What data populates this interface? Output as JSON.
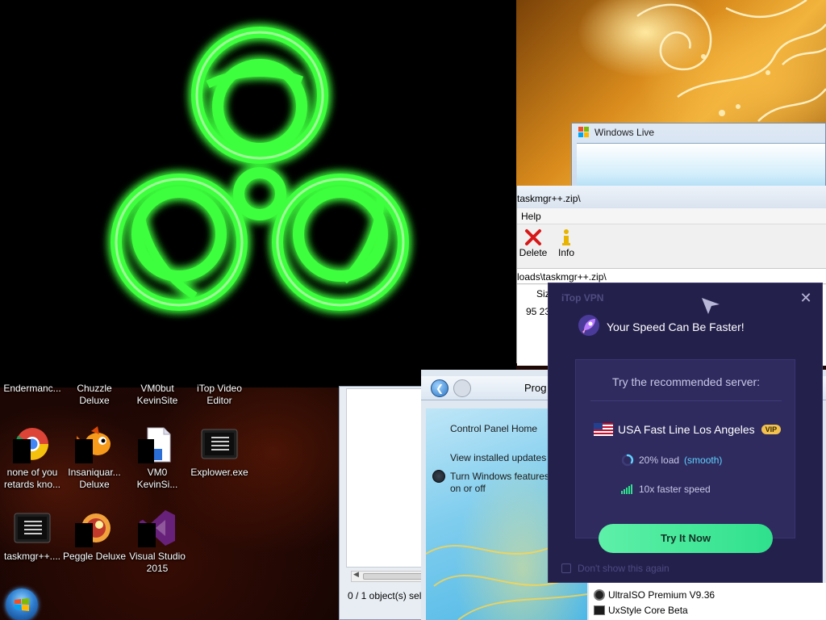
{
  "colors": {
    "vpn_bg": "#24204c",
    "vpn_card": "#2f2b5f",
    "vpn_button": "#2fe08c",
    "vip_badge": "#f2c14e",
    "accent_blue": "#5fd2ff",
    "biohazard_green": "#3dff3d"
  },
  "desktop": {
    "icons": [
      {
        "label": "Endermanc...",
        "icon": "app-icon"
      },
      {
        "label": "Chuzzle Deluxe",
        "icon": "chuzzle-icon"
      },
      {
        "label": "VM0but KevinSite",
        "icon": "file-icon"
      },
      {
        "label": "iTop Video Editor",
        "icon": "itop-video-icon"
      },
      {
        "label": "none of you retards kno...",
        "icon": "chrome-icon"
      },
      {
        "label": "Insaniquar... Deluxe",
        "icon": "insaniquarium-icon"
      },
      {
        "label": "VM0 KevinSi...",
        "icon": "document-icon"
      },
      {
        "label": "Explower.exe",
        "icon": "exe-icon"
      },
      {
        "label": "taskmgr++....",
        "icon": "exe-icon"
      },
      {
        "label": "Peggle Deluxe",
        "icon": "peggle-icon"
      },
      {
        "label": "Visual Studio 2015",
        "icon": "visual-studio-icon"
      }
    ]
  },
  "windows_live": {
    "title": "Windows Live"
  },
  "zip_window": {
    "path_title": "taskmgr++.zip\\",
    "menu": [
      "Help"
    ],
    "toolbar": [
      {
        "label": "Delete",
        "icon": "delete-x-icon"
      },
      {
        "label": "Info",
        "icon": "info-icon"
      }
    ],
    "path_bar": "loads\\taskmgr++.zip\\",
    "column_size": "Siz",
    "row_value": "95 23"
  },
  "explorer": {
    "status": "0 / 1 object(s) sel"
  },
  "control_panel": {
    "address_prefix": "Prog",
    "links": [
      "Control Panel Home",
      "View installed updates",
      "Turn Windows features on or off"
    ],
    "programs": [
      {
        "name": "UltraISO Premium V9.36",
        "icon": "ultraiso-icon"
      },
      {
        "name": "UxStyle Core Beta",
        "icon": "uxstyle-icon"
      }
    ]
  },
  "vpn": {
    "app_title": "iTop VPN",
    "headline": "Your Speed Can Be Faster!",
    "card_header": "Try the recommended server:",
    "server_name": "USA Fast Line Los Angeles",
    "vip_label": "VIP",
    "load_value": "20% load",
    "load_quality": "(smooth)",
    "speed_text": "10x faster speed",
    "cta_label": "Try It Now",
    "dont_show_label": "Don't show this again"
  }
}
